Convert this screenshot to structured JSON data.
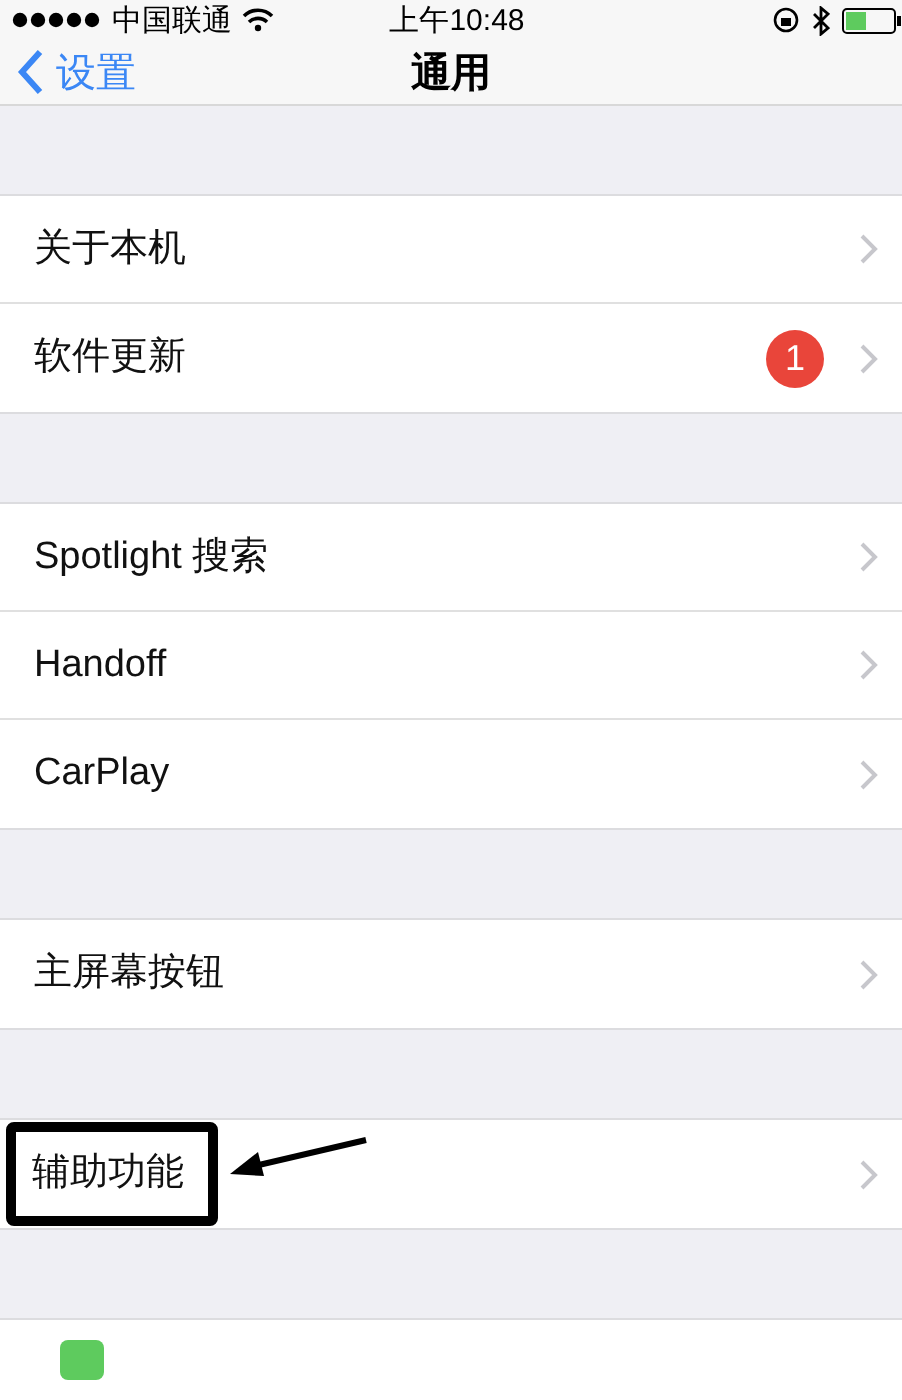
{
  "status_bar": {
    "carrier": "中国联通",
    "time": "上午10:48"
  },
  "nav": {
    "back": "设置",
    "title": "通用"
  },
  "groups": [
    {
      "items": [
        {
          "label": "关于本机",
          "highlighted": false
        },
        {
          "label": "软件更新",
          "badge": "1",
          "highlighted": false
        }
      ]
    },
    {
      "items": [
        {
          "label": "Spotlight 搜索",
          "highlighted": false
        },
        {
          "label": "Handoff",
          "highlighted": false
        },
        {
          "label": "CarPlay",
          "highlighted": false
        }
      ]
    },
    {
      "items": [
        {
          "label": "主屏幕按钮",
          "highlighted": false
        }
      ]
    },
    {
      "items": [
        {
          "label": "辅助功能",
          "highlighted": true
        }
      ]
    }
  ]
}
